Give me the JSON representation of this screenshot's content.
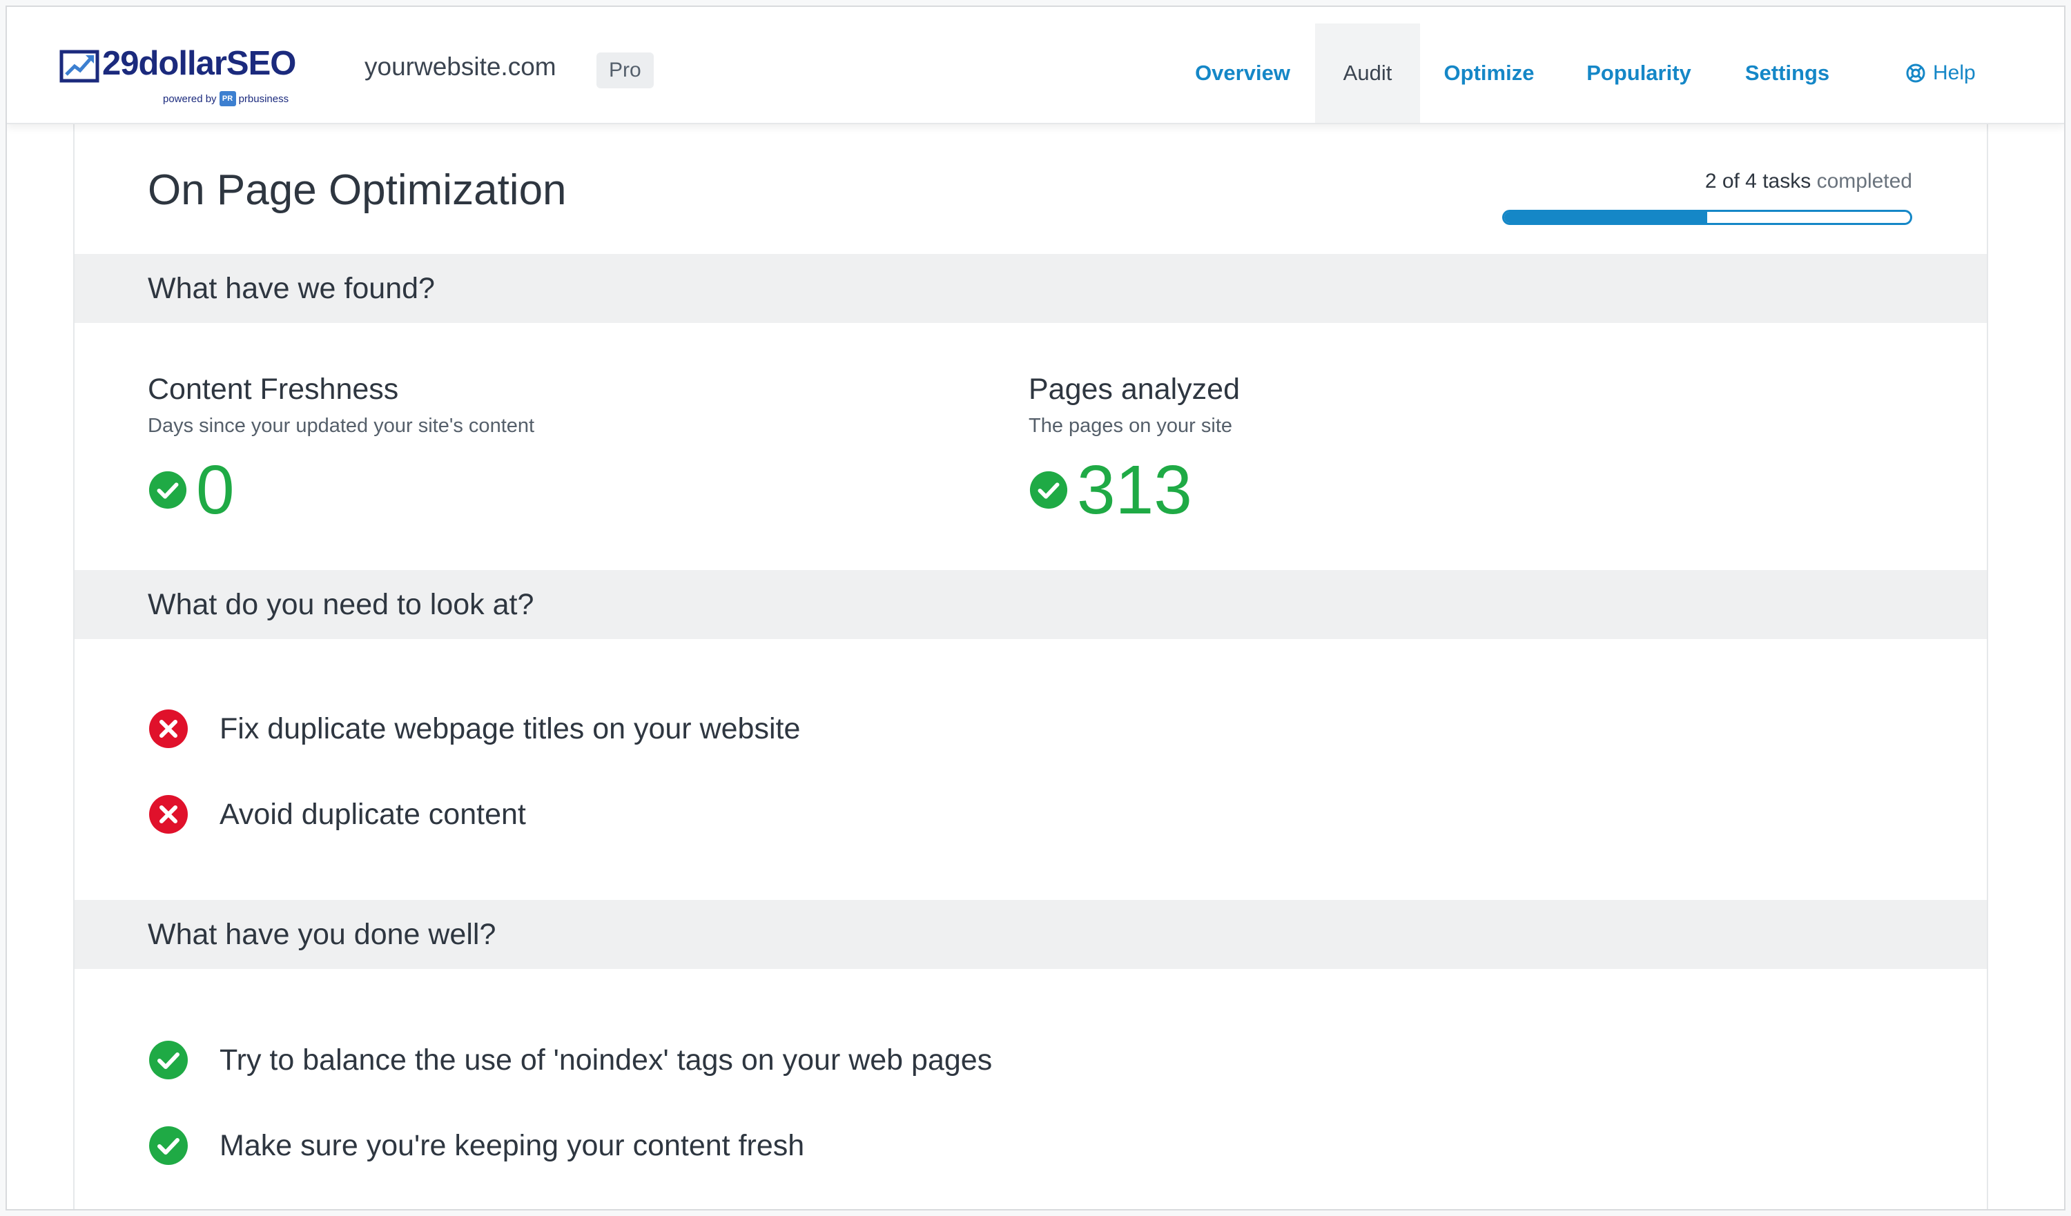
{
  "brand": {
    "name": "29dollarSEO",
    "powered_by": "powered by",
    "partner_mark": "PR",
    "partner": "prbusiness"
  },
  "site": {
    "domain": "yourwebsite.com",
    "plan": "Pro"
  },
  "nav": {
    "items": [
      {
        "label": "Overview",
        "active": false
      },
      {
        "label": "Audit",
        "active": true
      },
      {
        "label": "Optimize",
        "active": false
      },
      {
        "label": "Popularity",
        "active": false
      },
      {
        "label": "Settings",
        "active": false
      }
    ],
    "help_label": "Help"
  },
  "page": {
    "title": "On Page Optimization",
    "tasks": {
      "summary": "2 of 4 tasks",
      "suffix": "completed",
      "completed": 2,
      "total": 4,
      "progress_fraction": 0.5
    }
  },
  "sections": {
    "found": {
      "heading": "What have we found?",
      "metrics": [
        {
          "title": "Content Freshness",
          "subtitle": "Days since your updated your site's content",
          "value": "0",
          "status": "ok"
        },
        {
          "title": "Pages analyzed",
          "subtitle": "The pages on your site",
          "value": "313",
          "status": "ok"
        }
      ]
    },
    "look_at": {
      "heading": "What do you need to look at?",
      "items": [
        {
          "label": "Fix duplicate webpage titles on your website",
          "status": "error"
        },
        {
          "label": "Avoid duplicate content",
          "status": "error"
        }
      ]
    },
    "done_well": {
      "heading": "What have you done well?",
      "items": [
        {
          "label": "Try to balance the use of 'noindex' tags on your web pages",
          "status": "ok"
        },
        {
          "label": "Make sure you're keeping your content fresh",
          "status": "ok"
        }
      ]
    }
  },
  "colors": {
    "accent": "#1587c7",
    "success": "#1faa45",
    "error": "#e0112b",
    "brand": "#1b2a7d"
  }
}
